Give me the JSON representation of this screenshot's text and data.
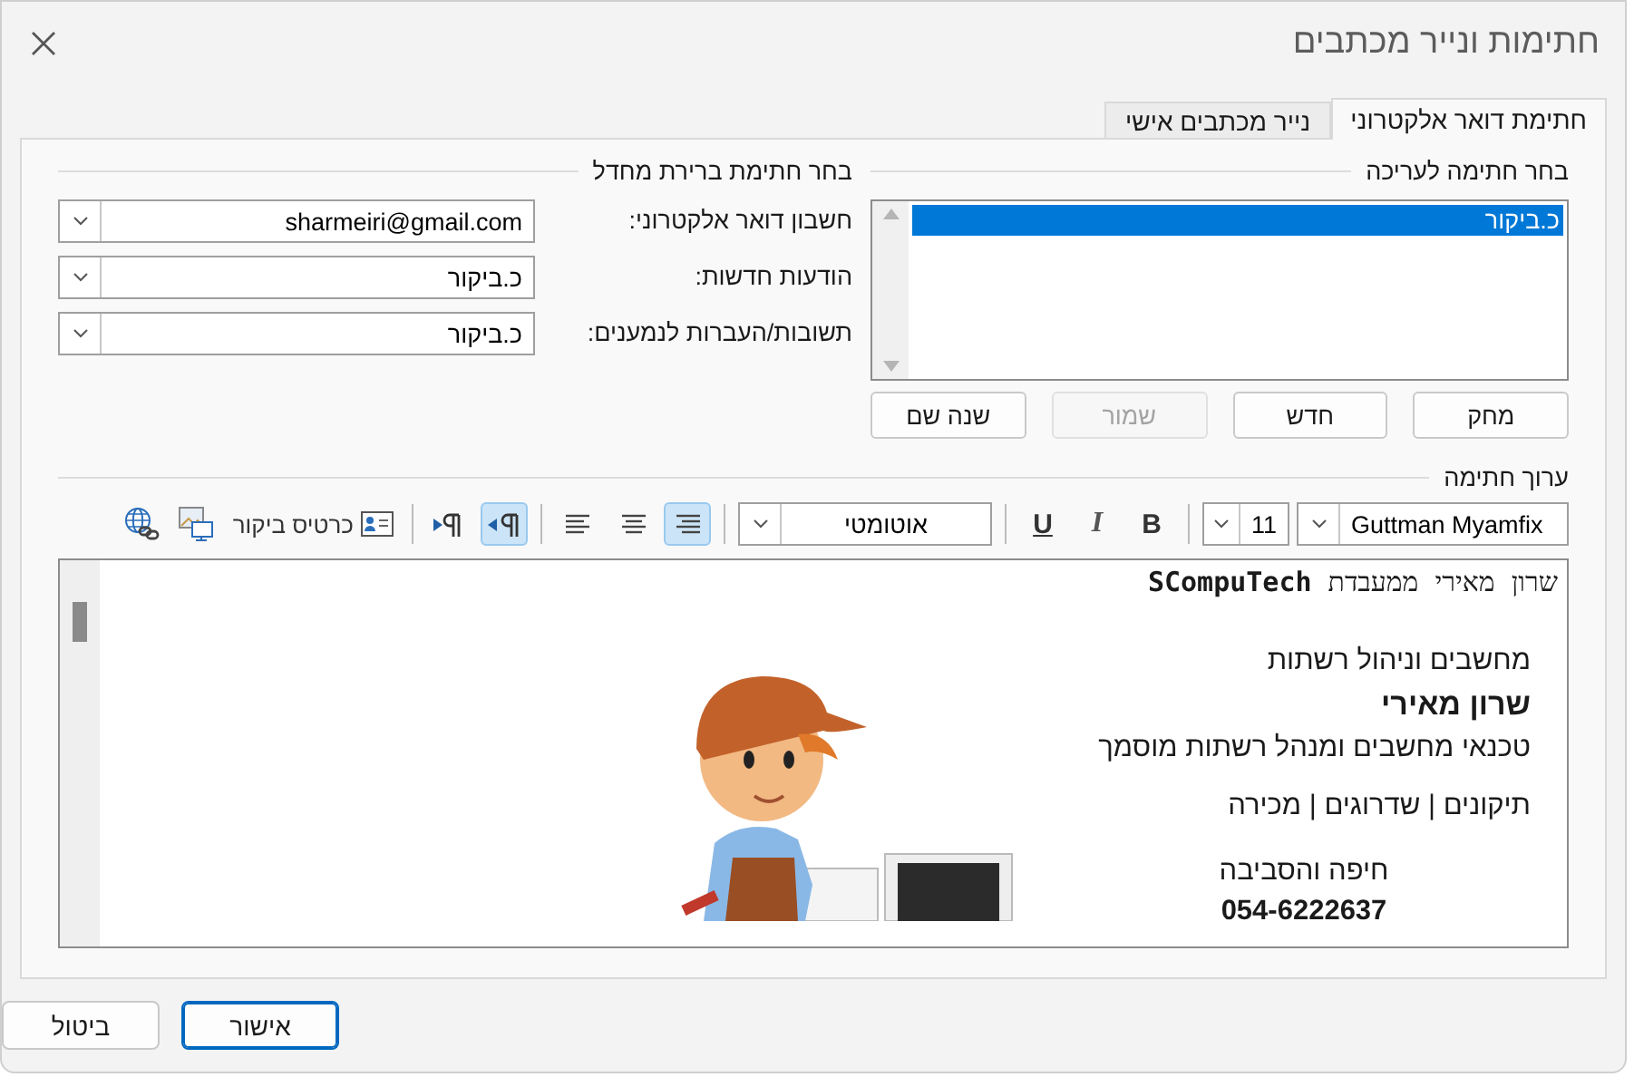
{
  "window": {
    "title": "חתימות ונייר מכתבים"
  },
  "tabs": [
    {
      "label": "חתימת דואר אלקטרוני",
      "selected": true
    },
    {
      "label": "נייר מכתבים אישי",
      "selected": false
    }
  ],
  "edit_section": {
    "heading": "בחר חתימה לעריכה",
    "signatures": [
      {
        "label": "כ.ביקור",
        "selected": true
      }
    ],
    "buttons": [
      {
        "label": "מחק",
        "disabled": false
      },
      {
        "label": "חדש",
        "disabled": false
      },
      {
        "label": "שמור",
        "disabled": true
      },
      {
        "label": "שנה שם",
        "disabled": false
      }
    ]
  },
  "defaults_section": {
    "heading": "בחר חתימת ברירת מחדל",
    "fields": [
      {
        "label": "חשבון דואר אלקטרוני:",
        "value": "sharmeiri@gmail.com"
      },
      {
        "label": "הודעות חדשות:",
        "value": "כ.ביקור"
      },
      {
        "label": "תשובות/העברות לנמענים:",
        "value": "כ.ביקור"
      }
    ]
  },
  "editor_section": {
    "heading": "ערוך חתימה",
    "toolbar": [
      {
        "kind": "font",
        "value": "Guttman Myamfix"
      },
      {
        "kind": "size",
        "value": "11"
      },
      {
        "kind": "separator"
      },
      {
        "kind": "bold",
        "label": "B",
        "selected": false
      },
      {
        "kind": "italic",
        "label": "I",
        "selected": false
      },
      {
        "kind": "underline",
        "label": "U",
        "selected": false
      },
      {
        "kind": "separator"
      },
      {
        "kind": "color",
        "value": "אוטומטי"
      },
      {
        "kind": "separator"
      },
      {
        "kind": "align-right",
        "selected": true
      },
      {
        "kind": "align-center",
        "selected": false
      },
      {
        "kind": "align-left",
        "selected": false
      },
      {
        "kind": "separator"
      },
      {
        "kind": "rtl",
        "selected": true
      },
      {
        "kind": "ltr",
        "selected": false
      },
      {
        "kind": "separator"
      },
      {
        "kind": "card",
        "label": "כרטיס ביקור"
      },
      {
        "kind": "picture"
      },
      {
        "kind": "link"
      }
    ],
    "content": {
      "intro": "שרון מאירי ממעבדת **SCompuTech**",
      "lines": [
        {
          "kind": "plain",
          "text": "מחשבים וניהול רשתות"
        },
        {
          "kind": "bold",
          "text": "שרון מאירי"
        },
        {
          "kind": "plain",
          "text": "טכנאי מחשבים ומנהל רשתות מוסמך"
        },
        {
          "kind": "spaced",
          "text": "תיקונים | שדרוגים | מכירה"
        },
        {
          "kind": "center",
          "text": "חיפה והסביבה"
        },
        {
          "kind": "phone",
          "text": "054-6222637"
        }
      ]
    }
  },
  "footer_buttons": [
    {
      "label": "אישור",
      "default": true
    },
    {
      "label": "ביטול",
      "default": false
    }
  ]
}
